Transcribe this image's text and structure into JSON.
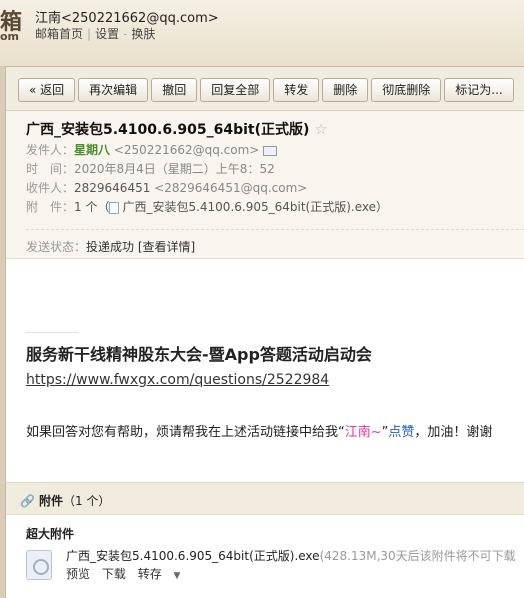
{
  "topbar": {
    "logo_big": "箱",
    "logo_small": "om",
    "user": "江南<250221662@qq.com>",
    "links": [
      "邮箱首页",
      "设置",
      "换肤"
    ]
  },
  "toolbar": {
    "buttons": [
      "« 返回",
      "再次编辑",
      "撤回",
      "回复全部",
      "转发",
      "删除",
      "彻底删除",
      "标记为..."
    ]
  },
  "mail": {
    "subject": "广西_安装包5.4100.6.905_64bit(正式版)",
    "star": "☆",
    "from_label": "发件人：",
    "from_name": "星期八",
    "from_addr": "<250221662@qq.com>",
    "time_label": "时　间：",
    "time_value": "2020年8月4日（星期二）上午8：52",
    "to_label": "收件人：",
    "to_name": "2829646451",
    "to_addr": "<2829646451@qq.com>",
    "attach_label": "附　件：",
    "attach_count": "1 个（",
    "attach_file": "广西_安装包5.4100.6.905_64bit(正式版).exe",
    "attach_close": "）",
    "status_label": "发送状态：",
    "status_value": "投递成功",
    "status_detail": "[查看详情]"
  },
  "body": {
    "title": "服务新干线精神股东大会-暨App答题活动启动会",
    "link": "https://www.fwxgx.com/questions/2522984",
    "text_prefix": "如果回答对您有帮助，烦请帮我在上述活动链接中给我“",
    "text_name": "江南~",
    "text_mid": "”",
    "text_like": "点赞",
    "text_suffix": "，加油！谢谢"
  },
  "attachments": {
    "header_label": "附件",
    "header_count": "（1 个）",
    "section_title": "超大附件",
    "file_name": "广西_安装包5.4100.6.905_64bit(正式版).exe",
    "file_meta": "(428.13M,30天后该附件将不可下载",
    "actions": [
      "预览",
      "下载",
      "转存"
    ]
  }
}
